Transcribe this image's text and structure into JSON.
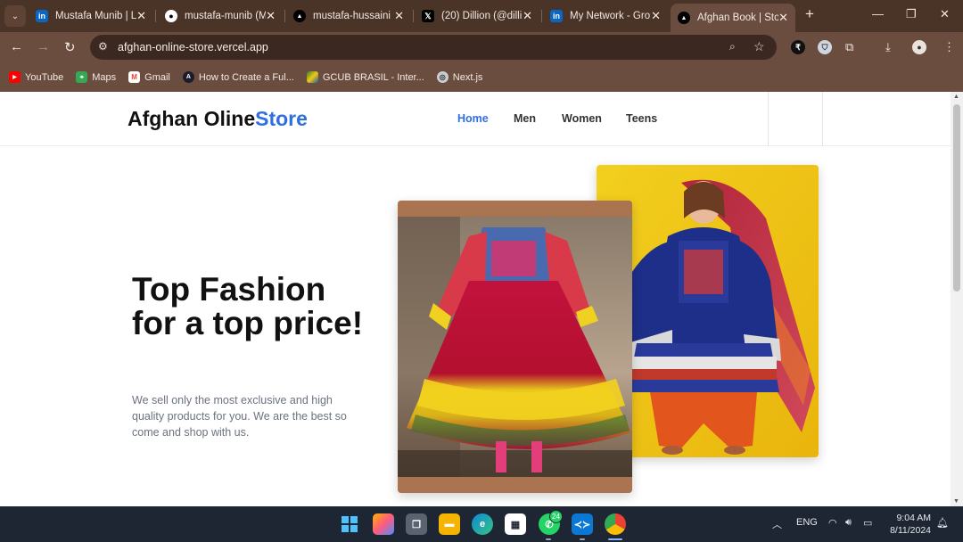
{
  "browser": {
    "tabs": [
      {
        "title": "Mustafa Munib | Li",
        "favicon": "linkedin-icon",
        "active": false
      },
      {
        "title": "mustafa-munib (M",
        "favicon": "github-icon",
        "active": false
      },
      {
        "title": "mustafa-hussaini",
        "favicon": "vercel-icon",
        "active": false
      },
      {
        "title": "(20) Dillion (@dilli",
        "favicon": "x-icon",
        "active": false
      },
      {
        "title": "My Network - Gro",
        "favicon": "linkedin-icon",
        "active": false
      },
      {
        "title": "Afghan Book | Sto",
        "favicon": "vercel-icon",
        "active": true
      }
    ],
    "url": "afghan-online-store.vercel.app",
    "bookmarks": [
      {
        "label": "YouTube",
        "icon": "youtube-icon"
      },
      {
        "label": "Maps",
        "icon": "maps-icon"
      },
      {
        "label": "Gmail",
        "icon": "gmail-icon"
      },
      {
        "label": "How to Create a Ful...",
        "icon": "site-icon"
      },
      {
        "label": "GCUB BRASIL - Inter...",
        "icon": "gcub-icon"
      },
      {
        "label": "Next.js",
        "icon": "globe-icon"
      }
    ]
  },
  "site": {
    "logo_main": "Afghan Oline",
    "logo_accent": "Store",
    "nav": [
      {
        "label": "Home",
        "active": true
      },
      {
        "label": "Men",
        "active": false
      },
      {
        "label": "Women",
        "active": false
      },
      {
        "label": "Teens",
        "active": false
      }
    ],
    "hero_title": "Top Fashion for a top price!",
    "hero_text": "We sell only the most exclusive and high quality products for you. We are the best so come and shop with us."
  },
  "taskbar": {
    "whatsapp_badge": "24",
    "language": "ENG",
    "time": "9:04 AM",
    "date": "8/11/2024"
  },
  "colors": {
    "accent": "#2f6fe0",
    "browser_frame": "#4a3327",
    "taskbar": "#1f2633"
  }
}
